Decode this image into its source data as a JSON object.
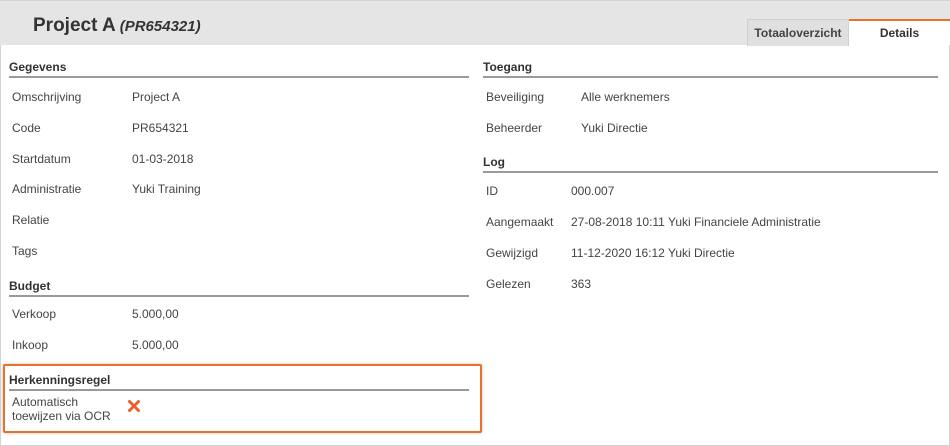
{
  "header": {
    "title": "Project A",
    "code": "(PR654321)"
  },
  "tabs": [
    {
      "label": "Totaaloverzicht",
      "active": false
    },
    {
      "label": "Details",
      "active": true
    }
  ],
  "gegevens": {
    "heading": "Gegevens",
    "rows": [
      {
        "label": "Omschrijving",
        "value": "Project A"
      },
      {
        "label": "Code",
        "value": "PR654321"
      },
      {
        "label": "Startdatum",
        "value": "01-03-2018"
      },
      {
        "label": "Administratie",
        "value": "Yuki Training"
      },
      {
        "label": "Relatie",
        "value": ""
      },
      {
        "label": "Tags",
        "value": ""
      }
    ]
  },
  "budget": {
    "heading": "Budget",
    "rows": [
      {
        "label": "Verkoop",
        "value": "5.000,00"
      },
      {
        "label": "Inkoop",
        "value": "5.000,00"
      }
    ]
  },
  "herkenningsregel": {
    "heading": "Herkenningsregel",
    "label_line1": "Automatisch",
    "label_line2": "toewijzen via OCR",
    "status_icon": "cross-icon"
  },
  "toegang": {
    "heading": "Toegang",
    "rows": [
      {
        "label": "Beveiliging",
        "value": "Alle werknemers"
      },
      {
        "label": "Beheerder",
        "value": "Yuki Directie"
      }
    ]
  },
  "log": {
    "heading": "Log",
    "rows": [
      {
        "label": "ID",
        "value": "000.007"
      },
      {
        "label": "Aangemaakt",
        "value": "27-08-2018 10:11 Yuki Financiele Administratie"
      },
      {
        "label": "Gewijzigd",
        "value": "11-12-2020 16:12 Yuki Directie"
      },
      {
        "label": "Gelezen",
        "value": "363"
      }
    ]
  },
  "colors": {
    "accent": "#e8722c",
    "cross": "#e8612c",
    "header_bg": "#e5e5e5"
  }
}
